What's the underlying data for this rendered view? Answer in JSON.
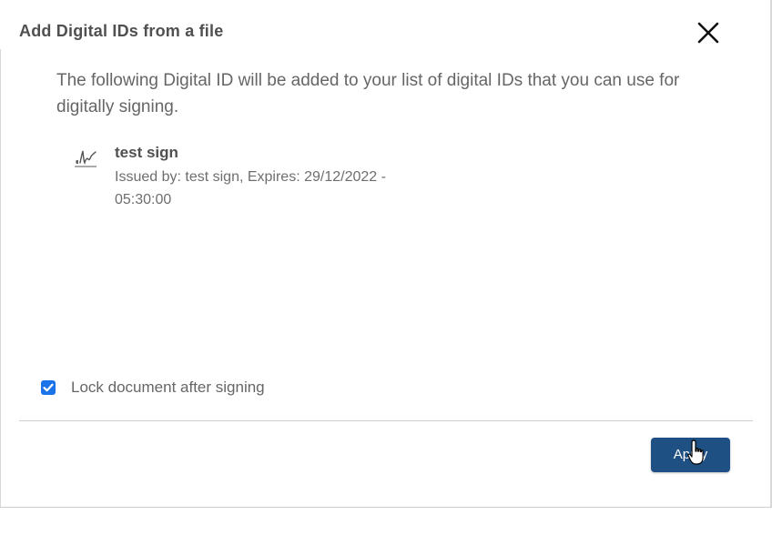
{
  "dialog": {
    "title": "Add Digital IDs from a file",
    "description": "The following Digital ID will be added to your list of digital IDs that you can use for digitally signing."
  },
  "digital_id": {
    "icon": "signature-icon",
    "name": "test sign",
    "details": "Issued by: test sign, Expires: 29/12/2022 - 05:30:00"
  },
  "options": {
    "lock_label": "Lock document after signing",
    "lock_checked": true
  },
  "footer": {
    "apply_label": "Apply"
  },
  "colors": {
    "primary_button": "#1e5083",
    "checkbox": "#1a73e8"
  }
}
